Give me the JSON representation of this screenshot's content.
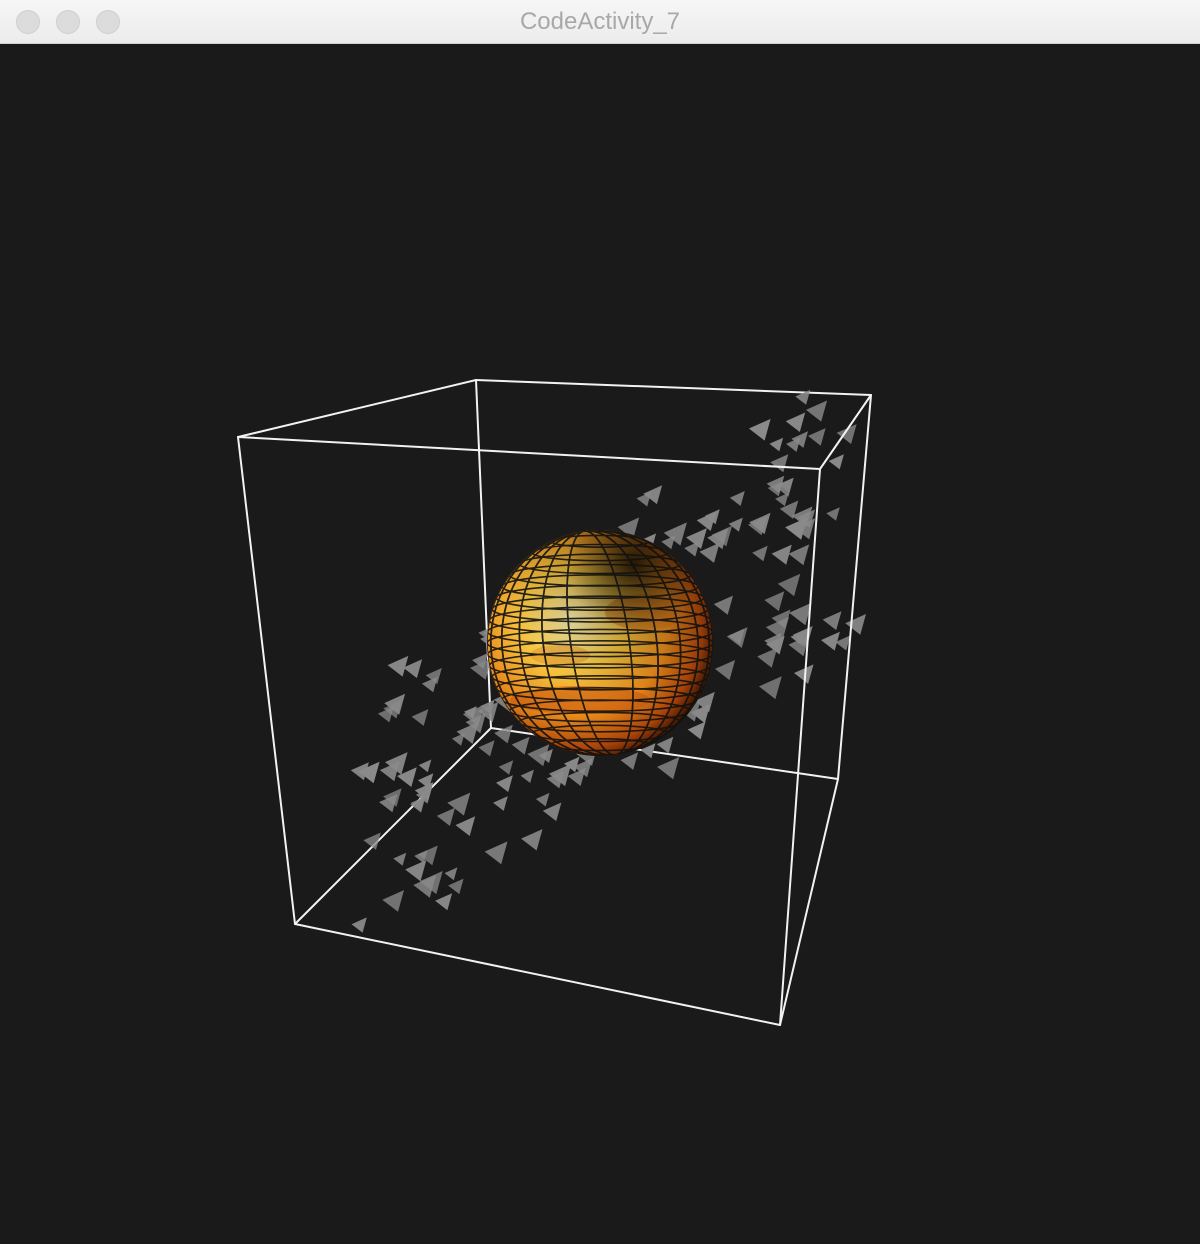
{
  "window": {
    "title": "CodeActivity_7"
  },
  "scene": {
    "background_color": "#1a1a1a",
    "cube_edge_color": "#f2f2f2",
    "particle_color": "#8a8a8a",
    "sphere_colors": [
      "#fff0a0",
      "#f7c640",
      "#e88a1a",
      "#b34a08",
      "#3a1400"
    ]
  }
}
